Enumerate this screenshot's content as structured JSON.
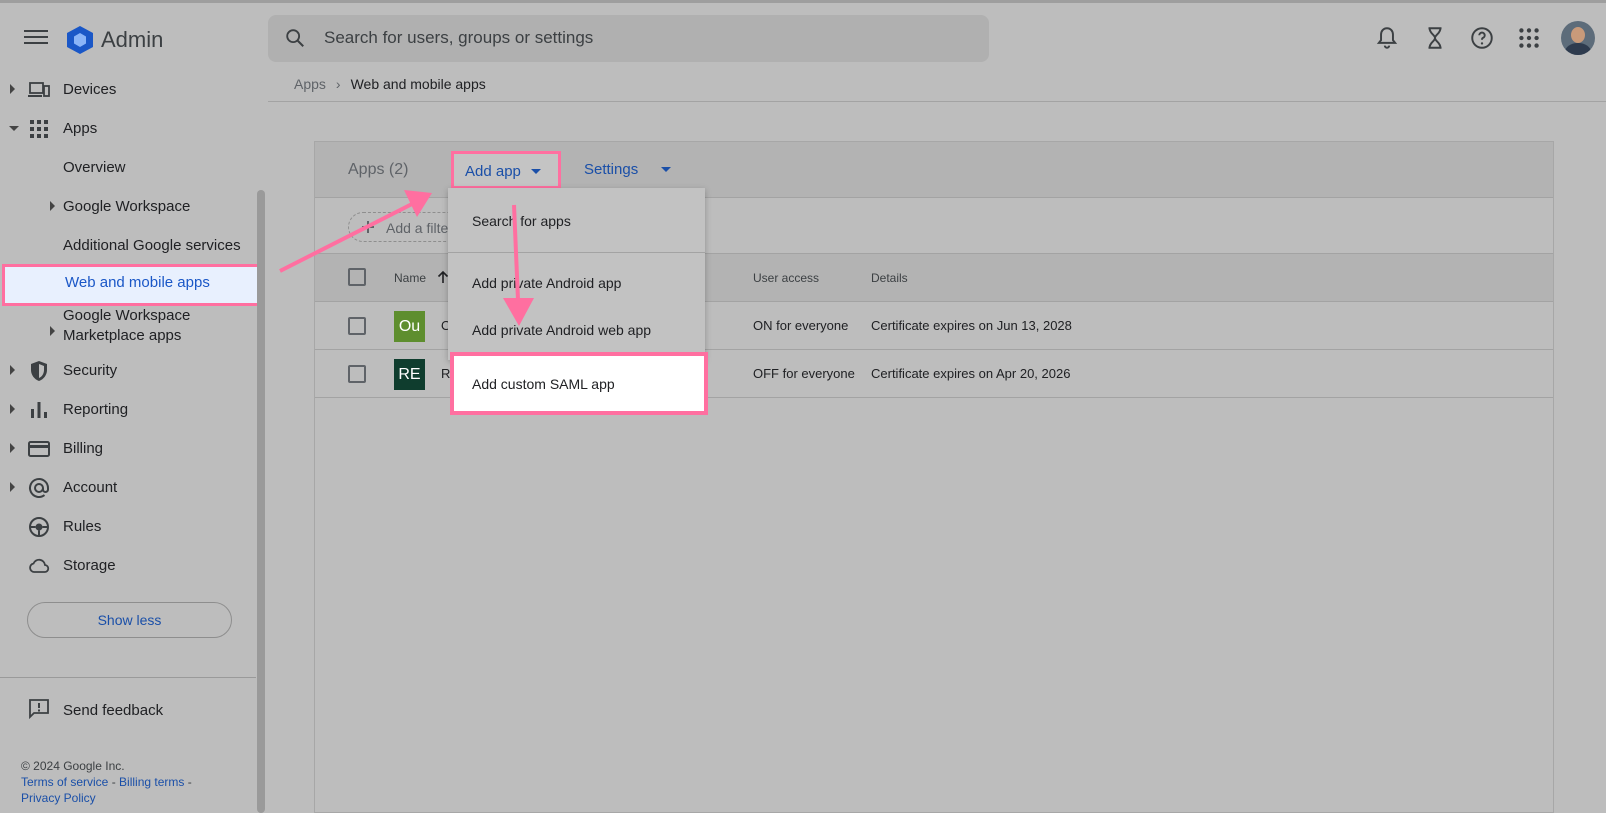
{
  "header": {
    "brand": "Admin",
    "search_placeholder": "Search for users, groups or settings",
    "icons": [
      "menu-icon",
      "admin-logo-icon",
      "search-icon",
      "notifications-icon",
      "tasks-hourglass-icon",
      "help-icon",
      "apps-grid-icon",
      "avatar"
    ]
  },
  "sidebar": {
    "items": [
      {
        "label": "Devices",
        "icon": "devices-icon"
      },
      {
        "label": "Apps",
        "icon": "apps-icon"
      },
      {
        "label": "Overview"
      },
      {
        "label": "Google Workspace"
      },
      {
        "label": "Additional Google services"
      },
      {
        "label": "Web and mobile apps"
      },
      {
        "label": "Google Workspace"
      },
      {
        "label": "Marketplace apps"
      },
      {
        "label": "Security",
        "icon": "shield-icon"
      },
      {
        "label": "Reporting",
        "icon": "bar-chart-icon"
      },
      {
        "label": "Billing",
        "icon": "credit-card-icon"
      },
      {
        "label": "Account",
        "icon": "at-sign-icon"
      },
      {
        "label": "Rules",
        "icon": "rules-icon"
      },
      {
        "label": "Storage",
        "icon": "cloud-icon"
      }
    ],
    "show_less": "Show less",
    "feedback": "Send feedback",
    "copyright": "© 2024 Google Inc.",
    "links": [
      "Terms of service",
      "Billing terms",
      "Privacy Policy"
    ],
    "link_separator": " - "
  },
  "breadcrumb": {
    "parent": "Apps",
    "separator": "›",
    "current": "Web and mobile apps"
  },
  "card": {
    "title": "Apps (2)",
    "add_app": "Add app",
    "settings": "Settings",
    "filter_placeholder": "Add a filte",
    "columns": {
      "name": "Name",
      "user_access": "User access",
      "details": "Details"
    },
    "rows": [
      {
        "logo_text": "Ou",
        "logo_color": "#5e8e2e",
        "name": "O",
        "user_access": "ON for everyone",
        "details": "Certificate expires on Jun 13, 2028"
      },
      {
        "logo_text": "RE",
        "logo_color": "#0f3d2e",
        "name": "R",
        "user_access": "OFF for everyone",
        "details": "Certificate expires on Apr 20, 2026"
      }
    ]
  },
  "dropdown": {
    "items": [
      "Search for apps",
      "Add private Android app",
      "Add private Android web app",
      "Add custom SAML app"
    ]
  },
  "colors": {
    "highlight": "#ff6fa0",
    "link_blue": "#1a4fa8",
    "overlay_gray": "#bdbdbd"
  }
}
